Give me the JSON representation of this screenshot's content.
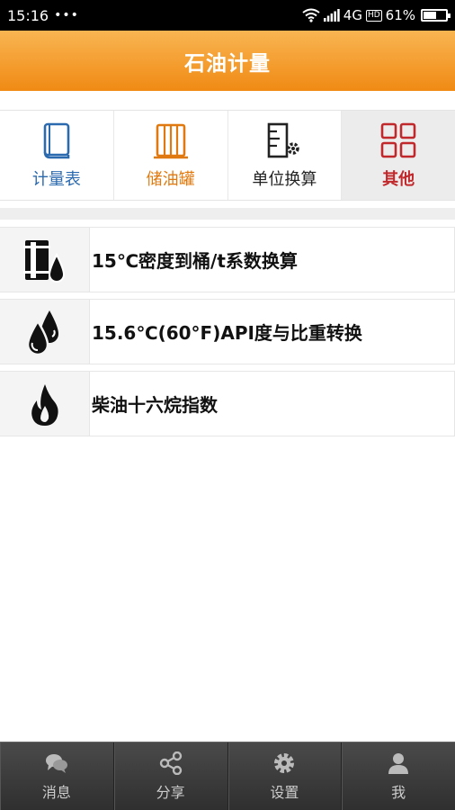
{
  "status_bar": {
    "time": "15:16",
    "dots": "•••",
    "network": "4G",
    "hd": "HD",
    "battery_text": "61%",
    "battery_level": 0.61
  },
  "header": {
    "title": "石油计量"
  },
  "tabs": [
    {
      "label": "计量表",
      "icon": "book-icon",
      "color": "#2b6aaf"
    },
    {
      "label": "储油罐",
      "icon": "tank-icon",
      "color": "#e07a10"
    },
    {
      "label": "单位换算",
      "icon": "unit-convert-icon",
      "color": "#222222"
    },
    {
      "label": "其他",
      "icon": "grid-icon",
      "color": "#c0282b"
    }
  ],
  "list": [
    {
      "label": "15℃密度到桶/t系数换算",
      "icon": "barrel-drop-icon"
    },
    {
      "label": "15.6℃(60°F)API度与比重转换",
      "icon": "oil-drops-icon"
    },
    {
      "label": "柴油十六烷指数",
      "icon": "flame-icon"
    }
  ],
  "bottom_nav": [
    {
      "label": "消息",
      "icon": "chat-icon"
    },
    {
      "label": "分享",
      "icon": "share-icon"
    },
    {
      "label": "设置",
      "icon": "gear-icon"
    },
    {
      "label": "我",
      "icon": "user-icon"
    }
  ]
}
